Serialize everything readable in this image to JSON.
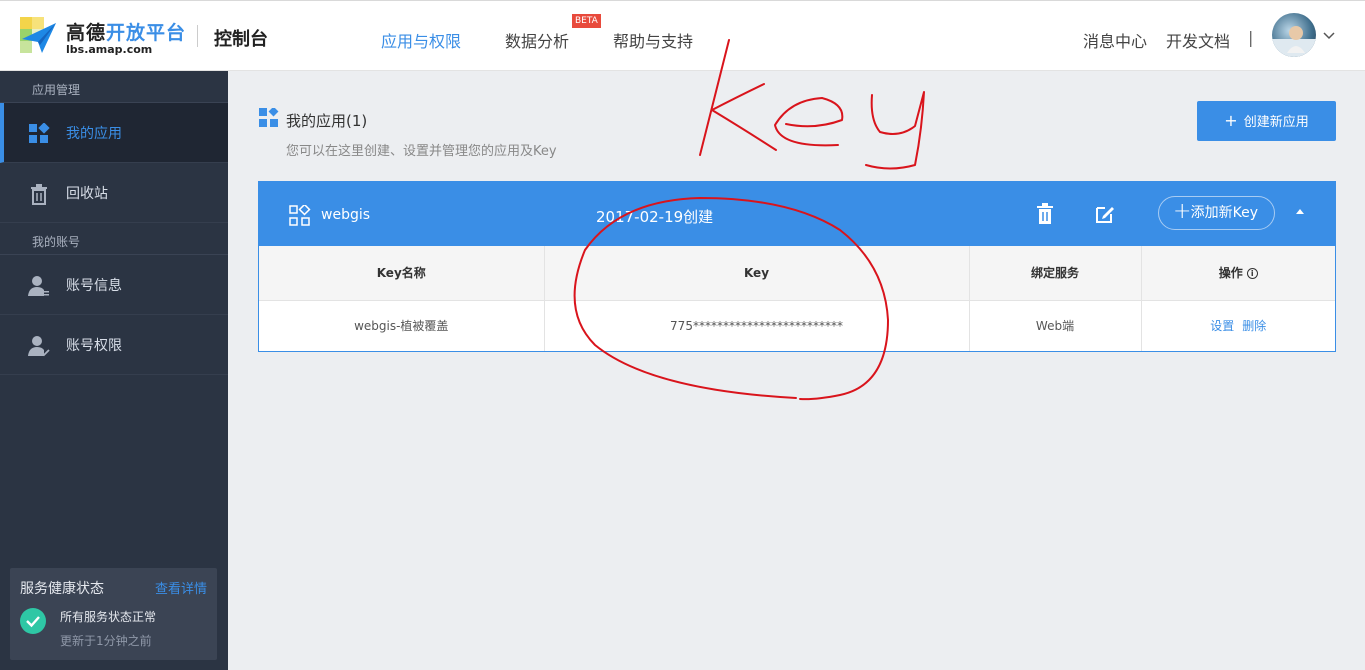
{
  "header": {
    "logo_cn_main": "高德",
    "logo_cn_accent": "开放平台",
    "logo_url": "lbs.amap.com",
    "console": "控制台",
    "nav": [
      {
        "label": "应用与权限",
        "active": true
      },
      {
        "label": "数据分析",
        "active": false
      },
      {
        "label": "帮助与支持",
        "active": false
      }
    ],
    "beta_badge": "BETA",
    "messages": "消息中心",
    "docs": "开发文档",
    "separator": "|"
  },
  "sidebar": {
    "section1": "应用管理",
    "items1": [
      {
        "label": "我的应用",
        "icon": "apps-icon",
        "active": true
      },
      {
        "label": "回收站",
        "icon": "trash-icon",
        "active": false
      }
    ],
    "section2": "我的账号",
    "items2": [
      {
        "label": "账号信息",
        "icon": "user-info-icon"
      },
      {
        "label": "账号权限",
        "icon": "user-permission-icon"
      }
    ],
    "health": {
      "title": "服务健康状态",
      "link": "查看详情",
      "status": "所有服务状态正常",
      "updated": "更新于1分钟之前"
    }
  },
  "main": {
    "title": "我的应用(1)",
    "subtitle": "您可以在这里创建、设置并管理您的应用及Key",
    "create_button": "创建新应用",
    "app": {
      "name": "webgis",
      "created": "2017-02-19创建",
      "add_key": "添加新Key",
      "columns": [
        "Key名称",
        "Key",
        "绑定服务",
        "操作"
      ],
      "rows": [
        {
          "name": "webgis-植被覆盖",
          "key": "775*************************",
          "service": "Web端",
          "ops": [
            "设置",
            "删除"
          ]
        }
      ]
    }
  },
  "annotation": {
    "handwritten_text": "Key",
    "color": "#d9141c"
  },
  "colors": {
    "accent": "#3a8ee6",
    "sidebar_bg": "#2b3443",
    "success": "#2ec7a5",
    "beta": "#e84a3c"
  }
}
